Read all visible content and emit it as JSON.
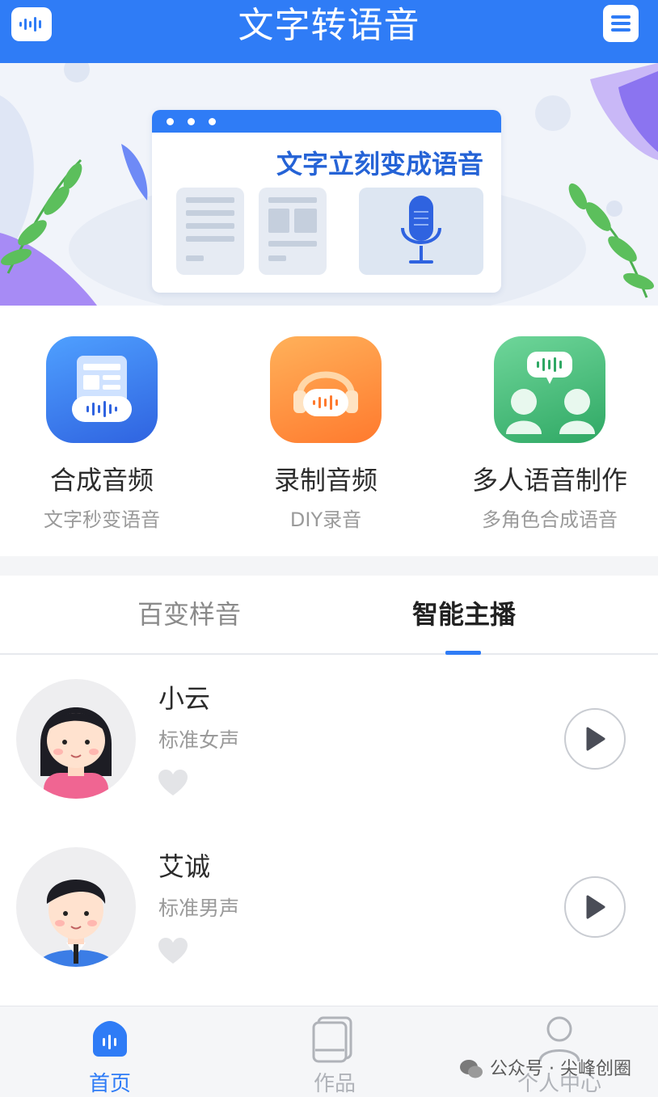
{
  "header": {
    "title": "文字转语音",
    "logo_icon": "waveform-icon",
    "menu_icon": "menu-icon",
    "accent": "#2f7cf6"
  },
  "banner": {
    "headline": "文字立刻变成语音"
  },
  "features": [
    {
      "name": "合成音频",
      "subtitle": "文字秒变语音",
      "icon": "document-waveform-icon",
      "color": "#3a7ef5"
    },
    {
      "name": "录制音频",
      "subtitle": "DIY录音",
      "icon": "headphones-icon",
      "color": "#ff8a3d"
    },
    {
      "name": "多人语音制作",
      "subtitle": "多角色合成语音",
      "icon": "people-chat-icon",
      "color": "#3fbf7a"
    }
  ],
  "tabs": [
    {
      "label": "百变样音",
      "active": false
    },
    {
      "label": "智能主播",
      "active": true
    }
  ],
  "voices": [
    {
      "name": "小云",
      "description": "标准女声",
      "avatar": "female-avatar",
      "favorited": false
    },
    {
      "name": "艾诚",
      "description": "标准男声",
      "avatar": "male-avatar",
      "favorited": false
    }
  ],
  "bottom_nav": [
    {
      "label": "首页",
      "icon": "home-waveform-icon",
      "active": true
    },
    {
      "label": "作品",
      "icon": "works-icon",
      "active": false
    },
    {
      "label": "个人中心",
      "icon": "person-icon",
      "active": false
    }
  ],
  "watermark": "公众号 · 尖峰创圈"
}
